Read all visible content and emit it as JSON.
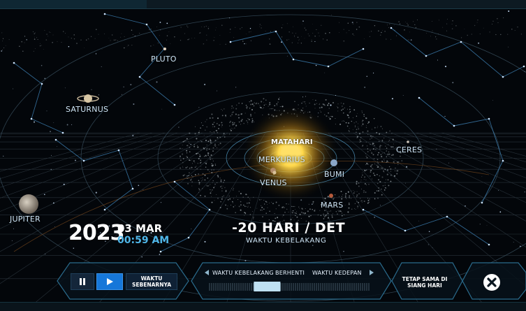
{
  "planets": {
    "pluto": "PLUTO",
    "saturnus": "SATURNUS",
    "matahari": "MATAHARI",
    "merkurius": "MERKURIUS",
    "venus": "VENUS",
    "bumi": "BUMI",
    "ceres": "CERES",
    "mars": "MARS",
    "jupiter": "JUPITER"
  },
  "datetime": {
    "year": "2023",
    "date": "03 MAR",
    "time": "00:59 AM"
  },
  "speed": {
    "rate": "-20 HARI / DET",
    "direction": "WAKTU KEBELAKANG"
  },
  "controls": {
    "real_time_line1": "WAKTU",
    "real_time_line2": "SEBENARNYA",
    "backward_label": "WAKTU KEBELAKANG",
    "stop_label": "BERHENTI",
    "forward_label": "WAKTU KEDEPAN",
    "same_day_line1": "TETAP SAMA DI",
    "same_day_line2": "SIANG HARI",
    "slider_level": 0.33
  },
  "icons": {
    "pause": "pause-icon",
    "play": "play-icon",
    "close": "close-icon"
  },
  "colors": {
    "accent_blue": "#1677d9",
    "time_blue": "#4fb6e8",
    "panel_border": "#2a6b8c",
    "sun": "#ffd84a"
  }
}
